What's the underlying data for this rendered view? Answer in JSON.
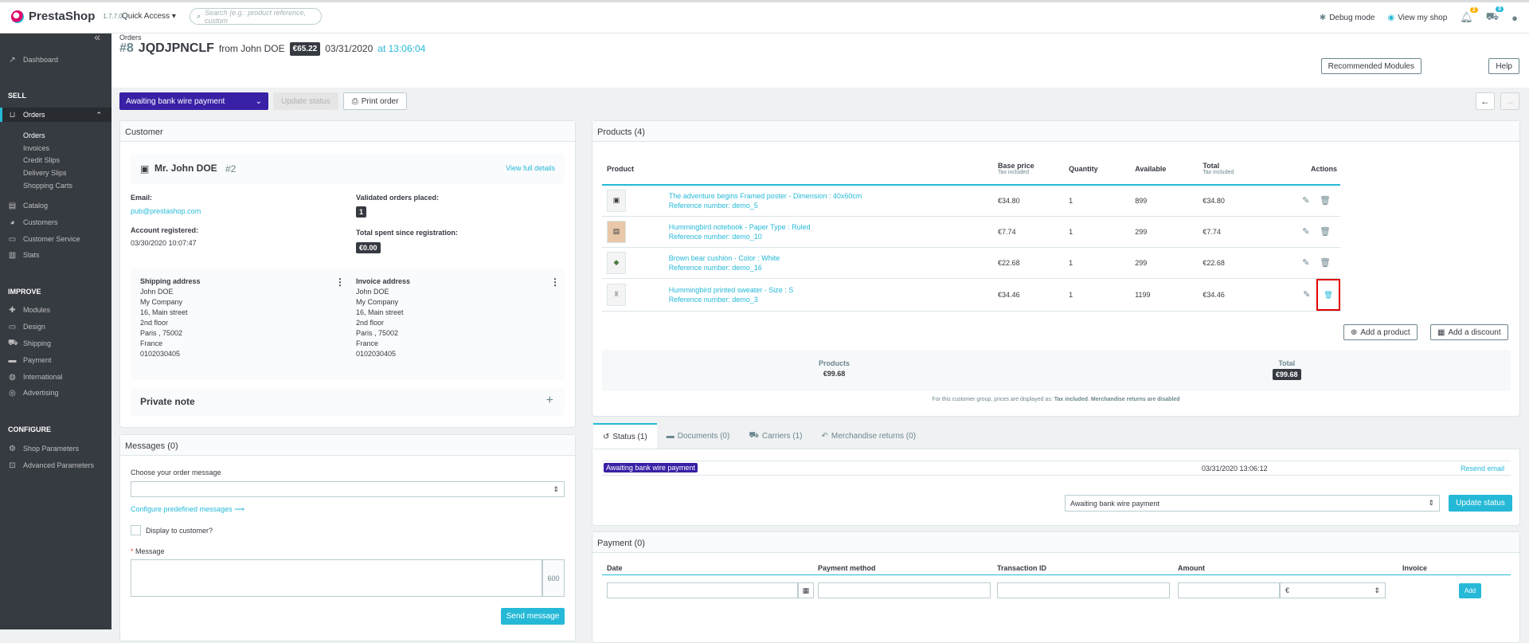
{
  "app": {
    "name": "PrestaShop",
    "version": "1.7.7.0"
  },
  "topbar": {
    "quick_access": "Quick Access",
    "search_placeholder": "Search (e.g.: product reference, custom",
    "debug": "Debug mode",
    "view_shop": "View my shop",
    "notif_orders": "2",
    "notif_customers": "0"
  },
  "sidebar": {
    "dashboard": "Dashboard",
    "sell": "SELL",
    "orders": "Orders",
    "orders_sub": [
      "Orders",
      "Invoices",
      "Credit Slips",
      "Delivery Slips",
      "Shopping Carts"
    ],
    "catalog": "Catalog",
    "customers": "Customers",
    "customer_service": "Customer Service",
    "stats": "Stats",
    "improve": "IMPROVE",
    "modules": "Modules",
    "design": "Design",
    "shipping": "Shipping",
    "payment": "Payment",
    "international": "International",
    "advertising": "Advertising",
    "configure": "CONFIGURE",
    "shop_params": "Shop Parameters",
    "advanced_params": "Advanced Parameters"
  },
  "header": {
    "breadcrumb": "Orders",
    "num": "#8",
    "ref": "JQDJPNCLF",
    "from": "from John DOE",
    "amount": "€65.22",
    "date": "03/31/2020",
    "at": "at 13:06:04",
    "rec_modules": "Recommended Modules",
    "help": "Help"
  },
  "actions": {
    "status": "Awaiting bank wire payment",
    "update": "Update status",
    "print": "Print order"
  },
  "customer": {
    "title": "Customer",
    "name": "Mr. John DOE",
    "id": "#2",
    "view_details": "View full details",
    "email_label": "Email:",
    "email": "pub@prestashop.com",
    "registered_label": "Account registered:",
    "registered": "03/30/2020 10:07:47",
    "validated_label": "Validated orders placed:",
    "validated": "1",
    "spent_label": "Total spent since registration:",
    "spent": "€0.00",
    "shipping_title": "Shipping address",
    "invoice_title": "Invoice address",
    "address": [
      "John DOE",
      "My Company",
      "16, Main street",
      "2nd floor",
      "Paris , 75002",
      "France",
      "0102030405"
    ],
    "private_note": "Private note"
  },
  "messages": {
    "title": "Messages (0)",
    "choose_label": "Choose your order message",
    "configure": "Configure predefined messages",
    "display": "Display to customer?",
    "message_label": "Message",
    "counter": "600",
    "send": "Send message"
  },
  "products": {
    "title": "Products (4)",
    "headers": {
      "product": "Product",
      "base": "Base price",
      "tax1": "Tax included",
      "qty": "Quantity",
      "avail": "Available",
      "total": "Total",
      "tax2": "Tax included",
      "actions": "Actions"
    },
    "rows": [
      {
        "name": "The adventure begins Framed poster - Dimension : 40x60cm",
        "ref": "Reference number: demo_5",
        "price": "€34.80",
        "qty": "1",
        "avail": "899",
        "total": "€34.80"
      },
      {
        "name": "Hummingbird notebook - Paper Type : Ruled",
        "ref": "Reference number: demo_10",
        "price": "€7.74",
        "qty": "1",
        "avail": "299",
        "total": "€7.74"
      },
      {
        "name": "Brown bear cushion - Color : White",
        "ref": "Reference number: demo_16",
        "price": "€22.68",
        "qty": "1",
        "avail": "299",
        "total": "€22.68"
      },
      {
        "name": "Hummingbird printed sweater - Size : S",
        "ref": "Reference number: demo_3",
        "price": "€34.46",
        "qty": "1",
        "avail": "1199",
        "total": "€34.46"
      }
    ],
    "add_product": "Add a product",
    "add_discount": "Add a discount",
    "sum_products_label": "Products",
    "sum_products": "€99.68",
    "sum_total_label": "Total",
    "sum_total": "€99.68",
    "note": "For this customer group, prices are displayed as:",
    "note_tax": "Tax included",
    "note_returns": "Merchandise returns are disabled"
  },
  "tabs": [
    {
      "label": "Status (1)"
    },
    {
      "label": "Documents (0)"
    },
    {
      "label": "Carriers (1)"
    },
    {
      "label": "Merchandise returns (0)"
    }
  ],
  "status": {
    "badge": "Awaiting bank wire payment",
    "date": "03/31/2020 13:06:12",
    "resend": "Resend email",
    "select": "Awaiting bank wire payment",
    "update": "Update status"
  },
  "payment": {
    "title": "Payment (0)",
    "date": "Date",
    "method": "Payment method",
    "txn": "Transaction ID",
    "amount": "Amount",
    "invoice": "Invoice",
    "currency": "€",
    "add": "Add"
  }
}
